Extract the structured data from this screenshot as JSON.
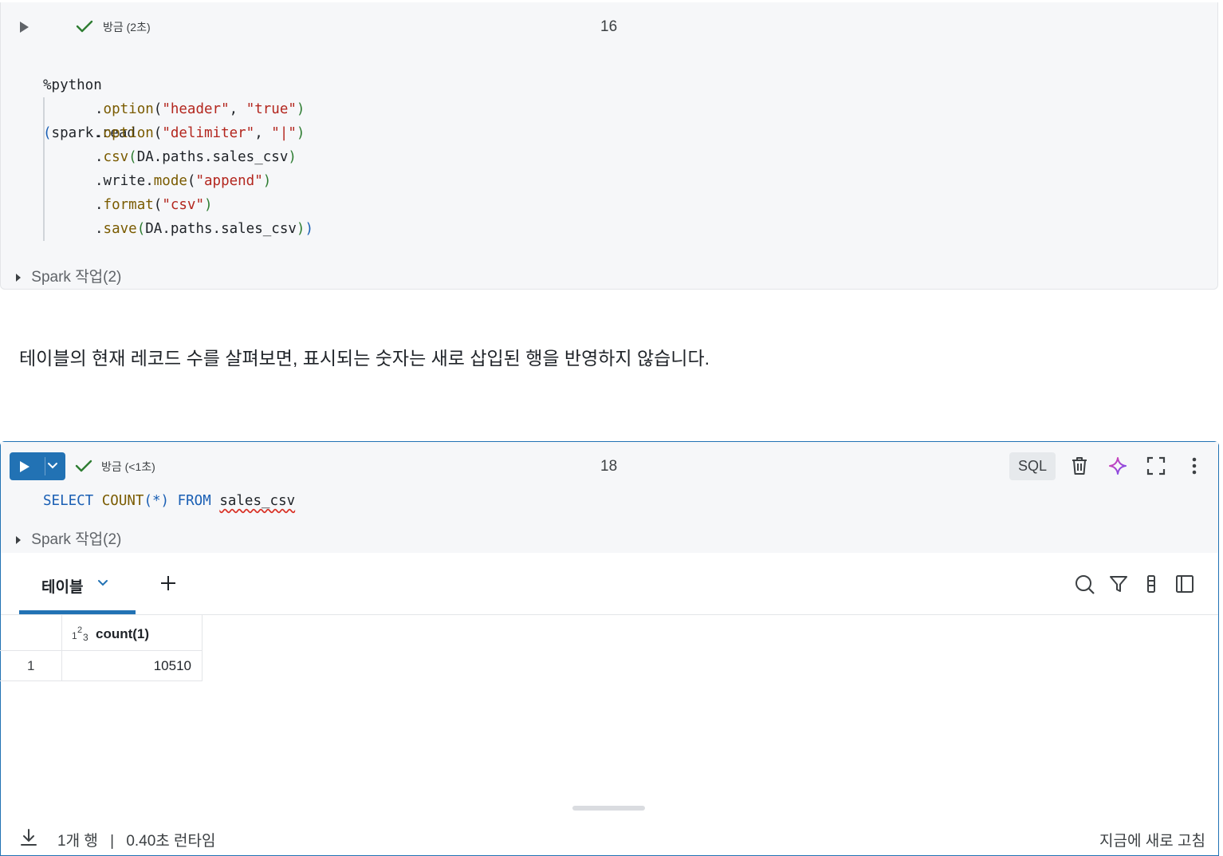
{
  "cell1": {
    "status": "방금 (2초)",
    "number": "16",
    "code_lines": [
      "%python",
      "(spark.read",
      "    .option(\"header\", \"true\")",
      "    .option(\"delimiter\", \"|\")",
      "    .csv(DA.paths.sales_csv)",
      "    .write.mode(\"append\")",
      "    .format(\"csv\")",
      "    .save(DA.paths.sales_csv))"
    ],
    "spark_jobs": "Spark 작업(2)"
  },
  "markdown": {
    "text": "테이블의 현재 레코드 수를 살펴보면, 표시되는 숫자는 새로 삽입된 행을 반영하지 않습니다."
  },
  "cell2": {
    "status": "방금 (<1초)",
    "number": "18",
    "language_badge": "SQL",
    "code": "SELECT COUNT(*) FROM sales_csv",
    "spark_jobs": "Spark 작업(2)",
    "icons": [
      "trash-icon",
      "ai-assistant-icon",
      "fullscreen-icon",
      "more-vert-icon"
    ]
  },
  "results": {
    "tab_label": "테이블",
    "add_tab": "+",
    "toolbar_icons": [
      "search-icon",
      "filter-icon",
      "column-settings-icon",
      "sidebar-panel-icon"
    ],
    "columns": [
      {
        "type_icon": "123",
        "name": "count(1)"
      }
    ],
    "rows": [
      {
        "index": "1",
        "values": [
          "10510"
        ]
      }
    ],
    "footer": {
      "row_count": "1개 행",
      "separator": "|",
      "runtime": "0.40초 런타임",
      "refreshed": "지금에 새로 고침"
    }
  },
  "colors": {
    "accent": "#2272b4",
    "cell_bg": "#f6f7f9",
    "success": "#2e7d32",
    "string": "#b3261e",
    "keyword": "#1a5fb4"
  }
}
